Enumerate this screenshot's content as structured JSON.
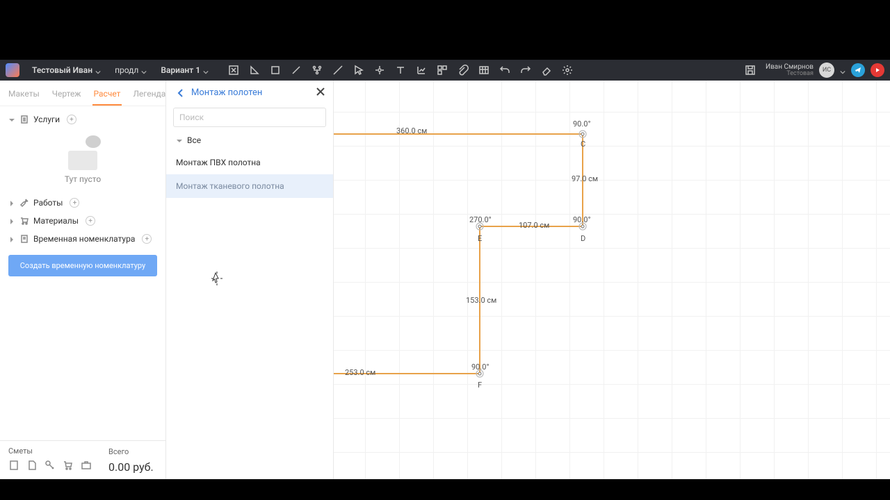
{
  "topbar": {
    "project": "Тестовый Иван",
    "crumb2": "продл",
    "variant": "Вариант 1",
    "user_name": "Иван Смирнов",
    "user_sub": "Тестовая",
    "avatar": "ИС"
  },
  "tabs": [
    "Макеты",
    "Чертеж",
    "Расчет",
    "Легенда"
  ],
  "active_tab": "Расчет",
  "tree": {
    "services": "Услуги",
    "empty": "Тут пусто",
    "works": "Работы",
    "materials": "Материалы",
    "temp_nom": "Временная номенклатура"
  },
  "blue_button": "Создать временную номенклатуру",
  "footer": {
    "smety": "Сметы",
    "vsego": "Всего",
    "total": "0.00 руб."
  },
  "panel": {
    "title": "Монтаж полотен",
    "search_placeholder": "Поиск",
    "filter": "Все",
    "items": [
      "Монтаж ПВХ полотна",
      "Монтаж тканевого полотна"
    ]
  },
  "canvas": {
    "top_len": "360.0 см",
    "c_angle": "90.0°",
    "c": "C",
    "cd_len": "97.0 см",
    "e_angle": "270.0°",
    "d_angle": "90.0°",
    "ed_len": "107.0 см",
    "e": "E",
    "d": "D",
    "ef_len": "153.0 см",
    "f_angle": "90.0°",
    "f": "F",
    "bottom_len": "253.0 см"
  }
}
